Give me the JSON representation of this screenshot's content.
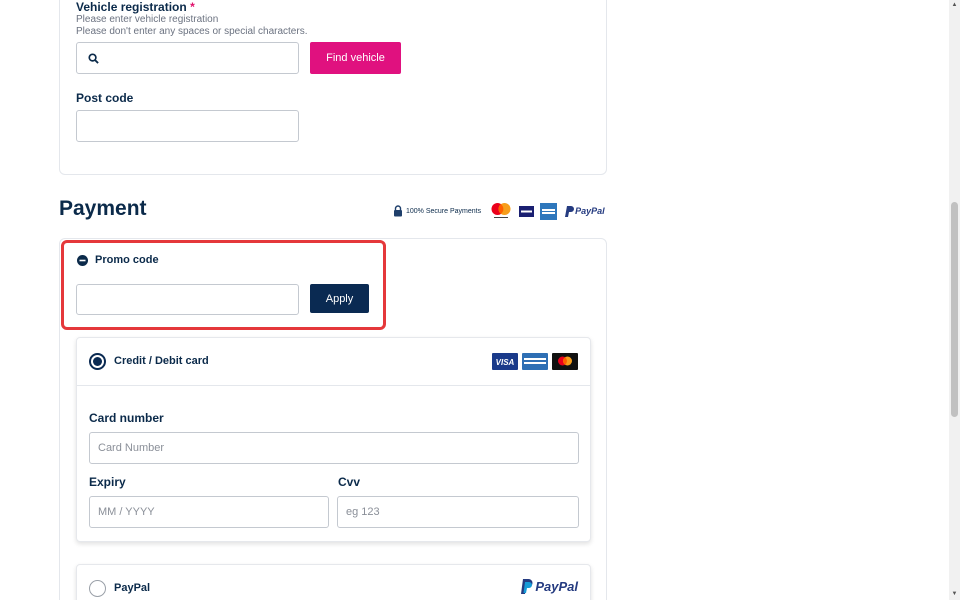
{
  "vehicle": {
    "registration_label": "Vehicle registration",
    "required_mark": "*",
    "hint_1": "Please enter vehicle registration",
    "hint_2": "Please don't enter any spaces or special characters.",
    "registration_value": "",
    "find_button": "Find vehicle",
    "postcode_label": "Post code",
    "postcode_value": ""
  },
  "payment": {
    "title": "Payment",
    "secure_text": "100% Secure Payments",
    "brand_logos": [
      "mastercard-logo",
      "visa-logo",
      "amex-logo",
      "paypal-logo"
    ],
    "paypal_wordmark": "PayPal"
  },
  "promo": {
    "label": "Promo code",
    "value": "",
    "apply_button": "Apply"
  },
  "card_method": {
    "label": "Credit / Debit card",
    "selected": true,
    "card_number_label": "Card number",
    "card_number_placeholder": "Card Number",
    "expiry_label": "Expiry",
    "expiry_placeholder": "MM / YYYY",
    "cvv_label": "Cvv",
    "cvv_placeholder": "eg 123"
  },
  "paypal_method": {
    "label": "PayPal",
    "selected": false,
    "wordmark": "PayPal"
  },
  "colors": {
    "brand_pink": "#e0117f",
    "navy": "#0a2a52",
    "highlight_red": "#e5383b"
  }
}
